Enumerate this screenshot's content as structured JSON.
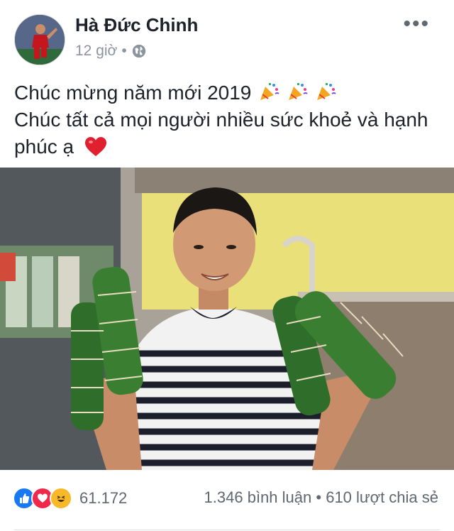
{
  "post": {
    "author": "Hà Đức Chinh",
    "time": "12 giờ",
    "separator": "•",
    "privacy_icon": "globe-icon",
    "more_icon": "more-horizontal-icon",
    "more_label": "•••"
  },
  "content": {
    "line1": "Chúc mừng năm mới 2019",
    "line1_emojis": [
      "party-popper-emoji",
      "party-popper-emoji",
      "party-popper-emoji"
    ],
    "line2": "Chúc tất cả mọi người nhiều sức khoẻ và hạnh",
    "line3": "phúc ạ",
    "line3_emoji": "red-heart-emoji"
  },
  "photo": {
    "description_icon": "photo-person-holding-banh-tet"
  },
  "footer": {
    "reaction_icons": [
      "like-icon",
      "love-icon",
      "haha-icon"
    ],
    "reaction_count": "61.172",
    "comments": "1.346 bình luận",
    "dot": "•",
    "shares": "610 lượt chia sẻ"
  },
  "colors": {
    "like": "#1877f2",
    "love": "#f0284a",
    "haha": "#f7b928",
    "text": "#1d2129",
    "muted": "#8d949e"
  }
}
